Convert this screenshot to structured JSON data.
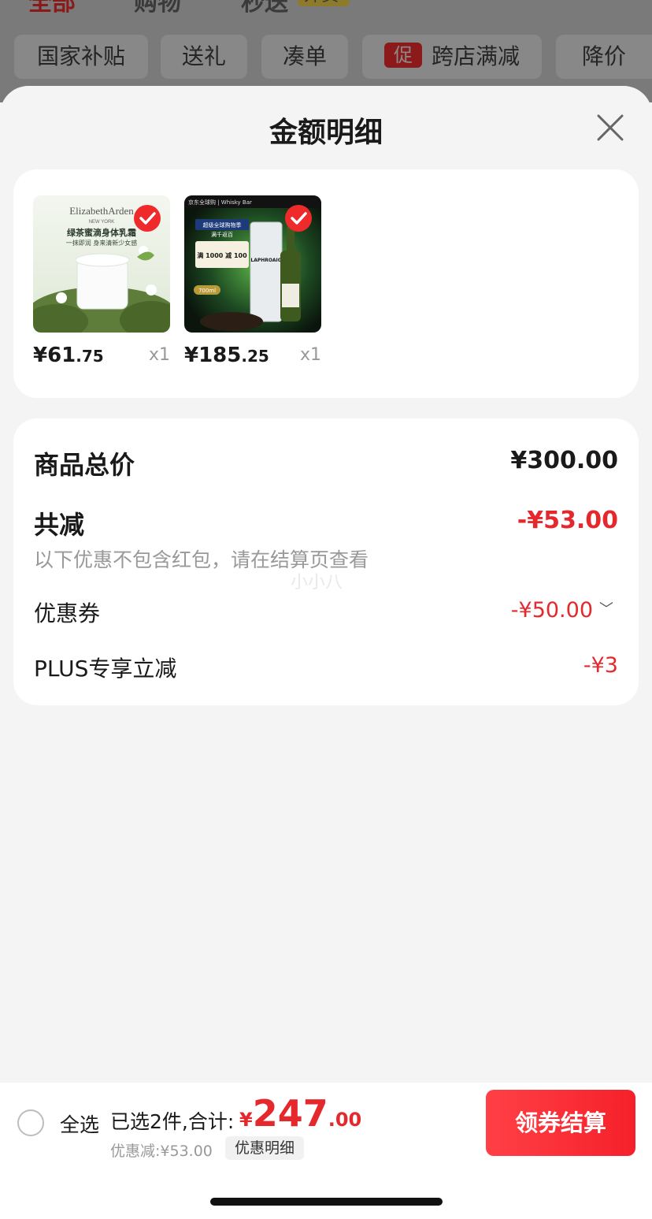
{
  "background": {
    "tabs": [
      {
        "label": "全部",
        "active": true
      },
      {
        "label": "购物",
        "active": false
      },
      {
        "label": "秒送",
        "active": false
      }
    ],
    "tab_badge": "外卖",
    "filter_chips": [
      {
        "label": "国家补贴"
      },
      {
        "label": "送礼"
      },
      {
        "label": "凑单"
      },
      {
        "label": "跨店满减",
        "promo_tag": "促"
      },
      {
        "label": "降价"
      }
    ]
  },
  "sheet": {
    "title": "金额明细"
  },
  "products": [
    {
      "name_image": "Elizabeth Arden body cream",
      "brand": "ElizabethArden",
      "brand_sub": "NEW YORK",
      "tagline": "绿茶蜜滴身体乳霜",
      "tagline_sub": "一抹即润 身来清新少女感",
      "price_int": "¥61",
      "price_dec": ".75",
      "qty": "x1",
      "checked": true
    },
    {
      "name_image": "Laphroaig whisky",
      "header": "京东全球购 | Whisky Bar",
      "promo_line1": "超级全球购物季",
      "promo_line2": "满千返百",
      "promo_line3": "满 1000 减 100",
      "volume": "700ml",
      "bottle_label": "LAPHROAIG",
      "price_int": "¥185",
      "price_dec": ".25",
      "qty": "x1",
      "checked": true
    }
  ],
  "summary": {
    "total_label": "商品总价",
    "total_value": "¥300.00",
    "reduce_label": "共减",
    "reduce_value": "-¥53.00",
    "note": "以下优惠不包含红包，请在结算页查看",
    "watermark": "小小八",
    "coupon_label": "优惠券",
    "coupon_value": "-¥50.00",
    "plus_label": "PLUS专享立减",
    "plus_value": "-¥3"
  },
  "bottom_bar": {
    "select_all": "全选",
    "selected": "已选2件,合计:",
    "total_currency": "¥",
    "total_int": "247",
    "total_dec": ".00",
    "discount": "优惠减:¥53.00",
    "detail_link": "优惠明细",
    "checkout": "领券结算"
  },
  "colors": {
    "accent": "#e4282c",
    "checkout_gradient_start": "#ff4046",
    "checkout_gradient_end": "#f5202a"
  }
}
